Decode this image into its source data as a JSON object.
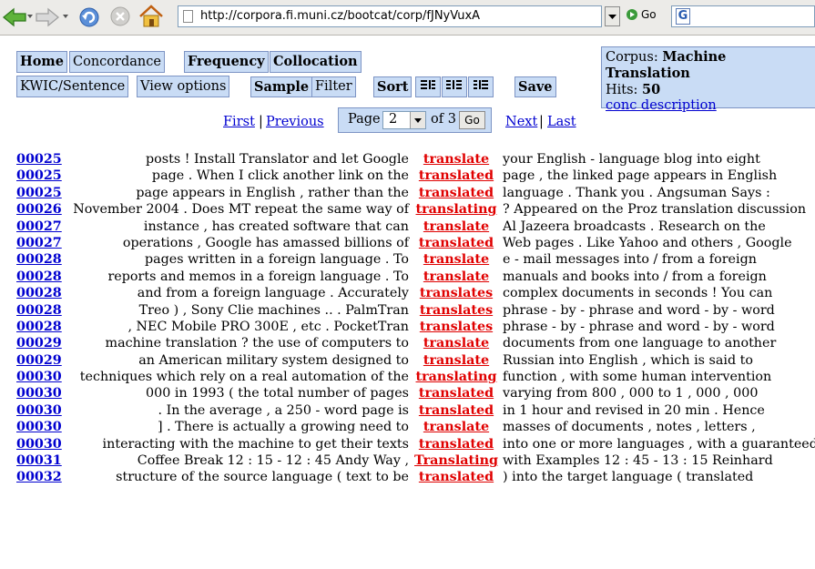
{
  "browser": {
    "url": "http://corpora.fi.muni.cz/bootcat/corp/fJNyVuxA",
    "go_label": "Go",
    "search_icon_letter": "G"
  },
  "nav": {
    "home": "Home",
    "concordance": "Concordance",
    "frequency": "Frequency",
    "collocation": "Collocation",
    "kwic_sentence": "KWIC/Sentence",
    "view_options": "View options",
    "sample": "Sample",
    "filter": "Filter",
    "sort": "Sort",
    "save": "Save"
  },
  "corpus_info": {
    "corpus_label": "Corpus:",
    "corpus_name": "Machine Translation",
    "hits_label": "Hits:",
    "hits_value": "50",
    "description_link": "conc description"
  },
  "paging": {
    "first": "First",
    "previous": "Previous",
    "page_label": "Page",
    "current_page": "2",
    "of_label": "of 3",
    "go": "Go",
    "next": "Next",
    "last": "Last",
    "separator": "|"
  },
  "concordance": [
    {
      "id": "00025",
      "left": "posts ! Install Translator and let Google",
      "kwic": "translate",
      "right": "your English - language blog into eight"
    },
    {
      "id": "00025",
      "left": "page . When I click another link on the",
      "kwic": "translated",
      "right": "page , the linked page appears in English"
    },
    {
      "id": "00025",
      "left": "page appears in English , rather than the",
      "kwic": "translated",
      "right": "language . Thank you . Angsuman Says :"
    },
    {
      "id": "00026",
      "left": "November 2004 . Does MT repeat the same way of",
      "kwic": "translating",
      "right": "? Appeared on the Proz translation discussion"
    },
    {
      "id": "00027",
      "left": "instance , has created software that can",
      "kwic": "translate",
      "right": "Al Jazeera broadcasts . Research on the"
    },
    {
      "id": "00027",
      "left": "operations , Google has amassed billions of",
      "kwic": "translated",
      "right": "Web pages . Like Yahoo and others , Google"
    },
    {
      "id": "00028",
      "left": "pages written in a foreign language . To",
      "kwic": "translate",
      "right": "e - mail messages into / from a foreign"
    },
    {
      "id": "00028",
      "left": "reports and memos in a foreign language . To",
      "kwic": "translate",
      "right": "manuals and books into / from a foreign"
    },
    {
      "id": "00028",
      "left": "and from a foreign language . Accurately",
      "kwic": "translates",
      "right": "complex documents in seconds ! You can"
    },
    {
      "id": "00028",
      "left": "Treo ) , Sony Clie machines .. . PalmTran",
      "kwic": "translates",
      "right": "phrase - by - phrase and word - by - word"
    },
    {
      "id": "00028",
      "left": ", NEC Mobile PRO 300E , etc . PocketTran",
      "kwic": "translates",
      "right": "phrase - by - phrase and word - by - word"
    },
    {
      "id": "00029",
      "left": "machine translation ? the use of computers to",
      "kwic": "translate",
      "right": "documents from one language to another"
    },
    {
      "id": "00029",
      "left": "an American military system designed to",
      "kwic": "translate",
      "right": "Russian into English , which is said to"
    },
    {
      "id": "00030",
      "left": "techniques which rely on a real automation of the",
      "kwic": "translating",
      "right": "function , with some human intervention"
    },
    {
      "id": "00030",
      "left": "000 in 1993 ( the total number of pages",
      "kwic": "translated",
      "right": "varying from 800 , 000 to 1 , 000 , 000"
    },
    {
      "id": "00030",
      "left": ". In the average , a 250 - word page is",
      "kwic": "translated",
      "right": "in 1 hour and revised in 20 min . Hence"
    },
    {
      "id": "00030",
      "left": "] . There is actually a growing need to",
      "kwic": "translate",
      "right": "masses of documents , notes , letters ,"
    },
    {
      "id": "00030",
      "left": "interacting with the machine to get their texts",
      "kwic": "translated",
      "right": "into one or more languages , with a guaranteed"
    },
    {
      "id": "00031",
      "left": "Coffee Break 12 : 15 - 12 : 45 Andy Way ,",
      "kwic": "Translating",
      "right": "with Examples 12 : 45 - 13 : 15 Reinhard"
    },
    {
      "id": "00032",
      "left": "structure of the source language ( text to be",
      "kwic": "translated",
      "right": ") into the target language ( translated"
    }
  ]
}
